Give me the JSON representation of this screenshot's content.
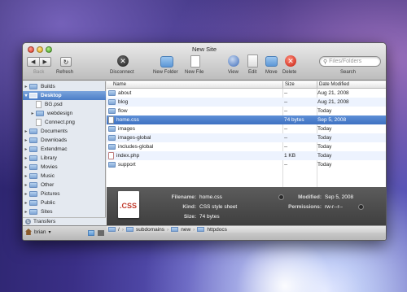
{
  "window": {
    "title": "New Site"
  },
  "toolbar": {
    "back": "Back",
    "refresh": "Refresh",
    "disconnect": "Disconnect",
    "new_folder": "New Folder",
    "new_file": "New File",
    "view": "View",
    "edit": "Edit",
    "move": "Move",
    "delete": "Delete",
    "search_placeholder": "Files/Folders",
    "search": "Search"
  },
  "sidebar": {
    "items": [
      {
        "label": "Builds",
        "kind": "folder",
        "disclosure": "▸"
      },
      {
        "label": "Desktop",
        "kind": "desktop",
        "disclosure": "▾"
      },
      {
        "label": "BG.psd",
        "kind": "file",
        "disclosure": ""
      },
      {
        "label": "webdesign",
        "kind": "folder",
        "disclosure": "▸"
      },
      {
        "label": "Connect.png",
        "kind": "file",
        "disclosure": ""
      },
      {
        "label": "Documents",
        "kind": "folder",
        "disclosure": "▸"
      },
      {
        "label": "Downloads",
        "kind": "folder",
        "disclosure": "▸"
      },
      {
        "label": "Extendmac",
        "kind": "folder",
        "disclosure": "▸"
      },
      {
        "label": "Library",
        "kind": "folder",
        "disclosure": "▸"
      },
      {
        "label": "Movies",
        "kind": "folder",
        "disclosure": "▸"
      },
      {
        "label": "Music",
        "kind": "folder",
        "disclosure": "▸"
      },
      {
        "label": "Other",
        "kind": "folder",
        "disclosure": "▸"
      },
      {
        "label": "Pictures",
        "kind": "folder",
        "disclosure": "▸"
      },
      {
        "label": "Public",
        "kind": "folder",
        "disclosure": "▸"
      },
      {
        "label": "Sites",
        "kind": "folder",
        "disclosure": "▸"
      }
    ],
    "transfers": "Transfers",
    "user": "brian"
  },
  "filelist": {
    "columns": {
      "name": "Name",
      "size": "Size",
      "date": "Date Modified"
    },
    "rows": [
      {
        "name": "about",
        "kind": "folder",
        "size": "--",
        "date": "Aug 21, 2008"
      },
      {
        "name": "blog",
        "kind": "folder",
        "size": "--",
        "date": "Aug 21, 2008"
      },
      {
        "name": "flow",
        "kind": "folder",
        "size": "--",
        "date": "Today"
      },
      {
        "name": "home.css",
        "kind": "css",
        "size": "74 bytes",
        "date": "Sep 5, 2008"
      },
      {
        "name": "images",
        "kind": "folder",
        "size": "--",
        "date": "Today"
      },
      {
        "name": "images-global",
        "kind": "folder",
        "size": "--",
        "date": "Today"
      },
      {
        "name": "includes-global",
        "kind": "folder",
        "size": "--",
        "date": "Today"
      },
      {
        "name": "index.php",
        "kind": "php",
        "size": "1 KB",
        "date": "Today"
      },
      {
        "name": "support",
        "kind": "folder",
        "size": "--",
        "date": "Today"
      }
    ]
  },
  "info": {
    "thumb": ".CSS",
    "filename_label": "Filename:",
    "filename": "home.css",
    "kind_label": "Kind:",
    "kind": "CSS style sheet",
    "size_label": "Size:",
    "size": "74 bytes",
    "modified_label": "Modified:",
    "modified": "Sep 5, 2008",
    "permissions_label": "Permissions:",
    "permissions": "rw-r--r--"
  },
  "path": [
    "/",
    "subdomains",
    "new",
    "httpdocs"
  ]
}
